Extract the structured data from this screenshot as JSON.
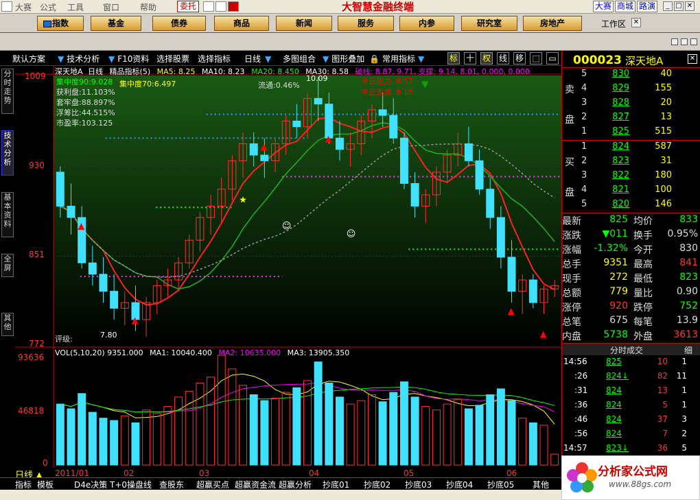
{
  "menubar": {
    "items": [
      "大赛",
      "公式",
      "工具",
      "窗口",
      "帮助"
    ],
    "trade_btn": "委托",
    "app_title": "大智慧金融终端",
    "right_buttons": [
      "大赛",
      "商城",
      "路演"
    ]
  },
  "navbar": {
    "buttons": [
      "指数",
      "基金",
      "债券",
      "商品",
      "新闻",
      "服务",
      "内参",
      "研究室",
      "房地产"
    ],
    "workspace": "工作区"
  },
  "toolbar": {
    "tabs": [
      "默认方案",
      "技术分析",
      "F10资料",
      "选择股票",
      "选择指标",
      "日线",
      "多图组合",
      "图形叠加",
      "常用指标"
    ],
    "toggles": [
      "标",
      "十",
      "权",
      "线",
      "移"
    ]
  },
  "left_tabs": [
    "分时走势",
    "技术分析",
    "基本资料",
    "全屏",
    "其他"
  ],
  "chart": {
    "header": {
      "name": "深天地A",
      "period": "日线",
      "indicator_title": "精品指标(5)",
      "ma5": "MA5: 8.25",
      "ma10": "MA10: 8.23",
      "ma20": "MA20: 8.450",
      "ma30": "MA30: 8.58",
      "break_line": "破线: 8.87, 9.71, 支撑: 9.14, 8.01, 0.000, 0.000"
    },
    "info_lines": [
      "集中度90:9.028",
      "获利盘:11.103%",
      "套牢盘:88.897%",
      "浮筹比:44.515%",
      "市盈率:103.125"
    ],
    "info_extra": {
      "conc70": "集中度70:6.497",
      "float": "流通:0.46%",
      "resist": "今日阻力: 8.57",
      "support": "今日支撑: 8.15",
      "hi_label": "10.09",
      "lo_label": "7.80",
      "rating": "评级:"
    },
    "price_axis": [
      "1009",
      "930",
      "851",
      "772"
    ],
    "vol_header": {
      "vol": "VOL(5,10,20) 9351.000",
      "ma1": "MA1: 10040.400",
      "ma2": "MA2: 10635.000",
      "ma3": "MA3: 13905.350"
    },
    "vol_axis": [
      "93636",
      "46818",
      "0"
    ],
    "date_axis": [
      "2011/01",
      "02",
      "03",
      "04",
      "05",
      "06"
    ]
  },
  "chart_data": {
    "type": "candlestick",
    "title": "深天地A 日线",
    "y_range": [
      7.72,
      10.09
    ],
    "ohlc": [
      [
        9.25,
        9.3,
        8.85,
        8.95
      ],
      [
        8.95,
        9.15,
        8.7,
        8.85
      ],
      [
        8.85,
        8.95,
        8.4,
        8.45
      ],
      [
        8.45,
        8.6,
        8.25,
        8.35
      ],
      [
        8.35,
        8.5,
        8.1,
        8.2
      ],
      [
        8.2,
        8.35,
        7.95,
        8.05
      ],
      [
        8.05,
        8.2,
        7.9,
        8.1
      ],
      [
        8.1,
        8.25,
        7.85,
        7.95
      ],
      [
        7.95,
        8.15,
        7.8,
        8.1
      ],
      [
        8.1,
        8.3,
        8.0,
        8.25
      ],
      [
        8.25,
        8.4,
        8.15,
        8.3
      ],
      [
        8.3,
        8.5,
        8.2,
        8.45
      ],
      [
        8.45,
        8.7,
        8.4,
        8.65
      ],
      [
        8.65,
        8.9,
        8.55,
        8.85
      ],
      [
        8.85,
        9.05,
        8.7,
        8.95
      ],
      [
        8.95,
        9.2,
        8.8,
        9.1
      ],
      [
        9.1,
        9.4,
        9.0,
        9.35
      ],
      [
        9.35,
        9.6,
        9.2,
        9.5
      ],
      [
        9.5,
        9.6,
        9.3,
        9.4
      ],
      [
        9.4,
        9.55,
        9.2,
        9.35
      ],
      [
        9.35,
        9.55,
        9.25,
        9.5
      ],
      [
        9.5,
        9.75,
        9.4,
        9.7
      ],
      [
        9.7,
        9.85,
        9.55,
        9.65
      ],
      [
        9.65,
        9.95,
        9.55,
        9.9
      ],
      [
        9.9,
        10.09,
        9.7,
        9.85
      ],
      [
        9.85,
        9.95,
        9.5,
        9.55
      ],
      [
        9.55,
        9.7,
        9.35,
        9.45
      ],
      [
        9.45,
        9.6,
        9.3,
        9.5
      ],
      [
        9.5,
        9.75,
        9.4,
        9.7
      ],
      [
        9.7,
        9.85,
        9.55,
        9.8
      ],
      [
        9.8,
        9.95,
        9.65,
        9.75
      ],
      [
        9.75,
        9.9,
        9.5,
        9.55
      ],
      [
        9.55,
        9.6,
        9.1,
        9.15
      ],
      [
        9.15,
        9.25,
        8.85,
        8.95
      ],
      [
        8.95,
        9.1,
        8.8,
        9.05
      ],
      [
        9.05,
        9.3,
        8.95,
        9.25
      ],
      [
        9.25,
        9.45,
        9.15,
        9.4
      ],
      [
        9.4,
        9.6,
        9.3,
        9.5
      ],
      [
        9.5,
        9.65,
        9.3,
        9.35
      ],
      [
        9.35,
        9.45,
        9.05,
        9.1
      ],
      [
        9.1,
        9.2,
        8.75,
        8.85
      ],
      [
        8.85,
        8.95,
        8.4,
        8.5
      ],
      [
        8.5,
        8.65,
        8.1,
        8.2
      ],
      [
        8.2,
        8.35,
        8.0,
        8.3
      ],
      [
        8.3,
        8.35,
        8.05,
        8.1
      ],
      [
        8.1,
        8.25,
        8.0,
        8.22
      ],
      [
        8.22,
        8.3,
        8.15,
        8.25
      ]
    ],
    "vol": [
      52000,
      48000,
      61000,
      45000,
      40000,
      38000,
      42000,
      36000,
      47000,
      44000,
      50000,
      58000,
      63000,
      70000,
      75000,
      93636,
      82000,
      68000,
      60000,
      55000,
      57000,
      62000,
      66000,
      72000,
      88000,
      70000,
      58000,
      52000,
      55000,
      60000,
      54000,
      62000,
      71000,
      58000,
      50000,
      47000,
      52000,
      56000,
      48000,
      51000,
      60000,
      65000,
      55000,
      40000,
      36000,
      34000,
      9351
    ],
    "ma_lines": {
      "MA5": "red",
      "MA10": "green",
      "MA20": "#aaaaaa"
    }
  },
  "quote": {
    "code": "000023",
    "name": "深天地A",
    "sell_label": [
      "卖",
      "盘"
    ],
    "buy_label": [
      "买",
      "盘"
    ],
    "asks": [
      {
        "lv": "5",
        "px": "830",
        "vol": "40"
      },
      {
        "lv": "4",
        "px": "829",
        "vol": "155"
      },
      {
        "lv": "3",
        "px": "828",
        "vol": "20"
      },
      {
        "lv": "2",
        "px": "827",
        "vol": "13"
      },
      {
        "lv": "1",
        "px": "825",
        "vol": "515"
      }
    ],
    "bids": [
      {
        "lv": "1",
        "px": "824",
        "vol": "587"
      },
      {
        "lv": "2",
        "px": "823",
        "vol": "31"
      },
      {
        "lv": "3",
        "px": "822",
        "vol": "180"
      },
      {
        "lv": "4",
        "px": "821",
        "vol": "100"
      },
      {
        "lv": "5",
        "px": "820",
        "vol": "146"
      }
    ],
    "stats": [
      [
        "最新",
        "825",
        "均价",
        "833"
      ],
      [
        "涨跌",
        "▼011",
        "换手",
        "0.95%"
      ],
      [
        "涨幅",
        "-1.32%",
        "今开",
        "830"
      ],
      [
        "总手",
        "9351",
        "最高",
        "841"
      ],
      [
        "现手",
        "272",
        "最低",
        "823"
      ],
      [
        "总额",
        "779",
        "量比",
        "0.90"
      ],
      [
        "涨停",
        "920",
        "跌停",
        "752"
      ],
      [
        "总笔",
        "675",
        "每笔",
        "13.9"
      ],
      [
        "内盘",
        "5738",
        "外盘",
        "3613"
      ]
    ],
    "ticks_header": "分时成交",
    "ticks_tab": "细",
    "ticks": [
      [
        "14:56",
        "825",
        "10",
        "1"
      ],
      [
        ":26",
        "824↓",
        "82",
        "11"
      ],
      [
        ":31",
        "824",
        "13",
        "1"
      ],
      [
        ":36",
        "824",
        "5",
        "1"
      ],
      [
        ":46",
        "824",
        "37",
        "3"
      ],
      [
        ":56",
        "824",
        "7",
        "2"
      ],
      [
        "14:57",
        "823↓",
        "36",
        "5"
      ]
    ]
  },
  "bottom": {
    "period": "日线",
    "tabs": [
      "指标",
      "模板",
      "D4e决策",
      "T+0操盘线",
      "查股东",
      "超赢买点",
      "超赢资金流",
      "超赢分析",
      "抄底01",
      "抄底02",
      "抄底03",
      "抄底04",
      "抄底05",
      "其他"
    ]
  },
  "logo": {
    "text": "分析家公式网",
    "url": "www.88gs.com"
  }
}
